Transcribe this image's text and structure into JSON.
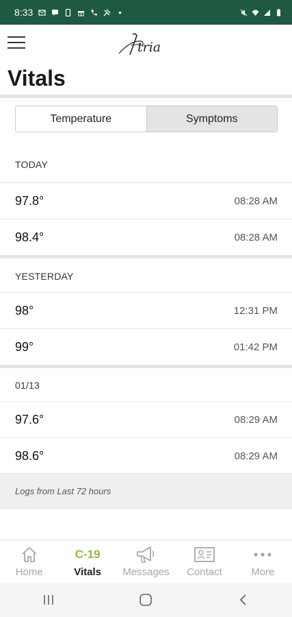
{
  "status_bar": {
    "time": "8:33",
    "background": "#1e5a42",
    "left_icons": [
      "mail-icon",
      "chat-icon",
      "phone-icon",
      "gift-icon",
      "call-icon",
      "tool-icon",
      "dot-icon"
    ],
    "right_icons": [
      "mute-icon",
      "wifi-icon",
      "signal-icon",
      "battery-icon"
    ]
  },
  "app": {
    "logo_text": "Atria",
    "menu_icon": "hamburger-icon"
  },
  "page": {
    "title": "Vitals"
  },
  "tabs": [
    {
      "label": "Temperature",
      "active": true
    },
    {
      "label": "Symptoms",
      "active": false
    }
  ],
  "sections": [
    {
      "header": "TODAY",
      "entries": [
        {
          "temp": "97.8°",
          "time": "08:28 AM"
        },
        {
          "temp": "98.4°",
          "time": "08:28 AM"
        }
      ]
    },
    {
      "header": "YESTERDAY",
      "entries": [
        {
          "temp": "98°",
          "time": "12:31 PM"
        },
        {
          "temp": "99°",
          "time": "01:42 PM"
        }
      ]
    },
    {
      "header": "01/13",
      "entries": [
        {
          "temp": "97.6°",
          "time": "08:29 AM"
        },
        {
          "temp": "98.6°",
          "time": "08:29 AM"
        }
      ]
    }
  ],
  "footer_note": "Logs from Last 72 hours",
  "bottom_nav": {
    "active_color": "#8bbf3f",
    "items": [
      {
        "label": "Home",
        "icon": "home-icon",
        "active": false
      },
      {
        "label": "Vitals",
        "icon_text": "C-19",
        "active": true
      },
      {
        "label": "Messages",
        "icon": "megaphone-icon",
        "active": false
      },
      {
        "label": "Contact",
        "icon": "contact-card-icon",
        "active": false
      },
      {
        "label": "More",
        "icon": "more-dots-icon",
        "active": false
      }
    ]
  },
  "system_nav": [
    "recents-icon",
    "home-circle-icon",
    "back-icon"
  ]
}
